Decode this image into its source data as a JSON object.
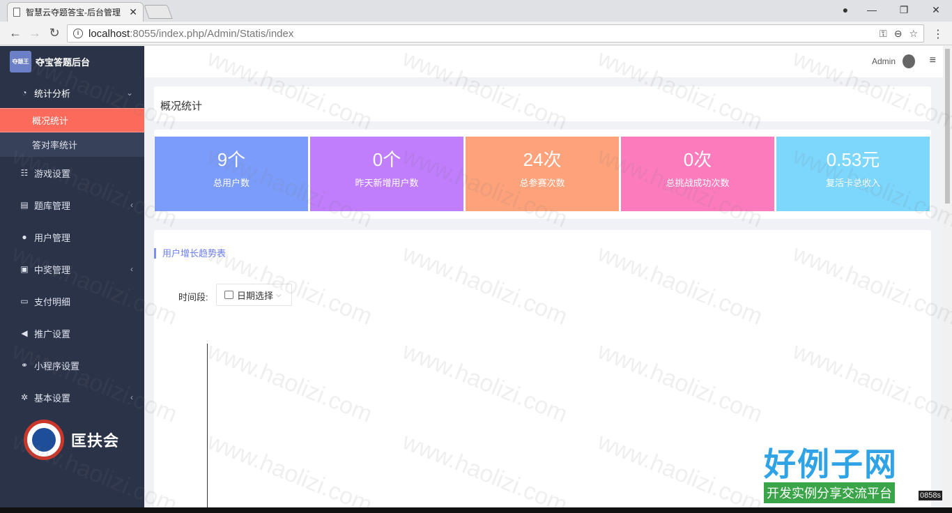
{
  "browser": {
    "tab_title": "智慧云夺题答宝-后台管理",
    "tab_close": "✕",
    "url_host": "localhost",
    "url_path": ":8055/index.php/Admin/Statis/index",
    "win_min": "—",
    "win_max": "❐",
    "win_close": "✕",
    "back": "←",
    "forward": "→",
    "reload": "↻",
    "menu": "⋮"
  },
  "sidebar": {
    "brand_logo_text": "夺题王",
    "brand_name": "夺宝答题后台",
    "group_open": {
      "label": "统计分析",
      "icon": "pie-chart-icon",
      "glyph": "◔",
      "caret": "⌄"
    },
    "sub_items": [
      {
        "label": "概况统计",
        "active": true
      },
      {
        "label": "答对率统计",
        "active": false
      }
    ],
    "items": [
      {
        "label": "游戏设置",
        "icon": "gamepad-icon",
        "glyph": "☷",
        "caret": ""
      },
      {
        "label": "题库管理",
        "icon": "list-icon",
        "glyph": "▤",
        "caret": "‹"
      },
      {
        "label": "用户管理",
        "icon": "user-icon",
        "glyph": "●",
        "caret": ""
      },
      {
        "label": "中奖管理",
        "icon": "award-icon",
        "glyph": "▣",
        "caret": "‹"
      },
      {
        "label": "支付明细",
        "icon": "card-icon",
        "glyph": "▭",
        "caret": ""
      },
      {
        "label": "推广设置",
        "icon": "bullhorn-icon",
        "glyph": "◀",
        "caret": ""
      },
      {
        "label": "小程序设置",
        "icon": "link-icon",
        "glyph": "⚭",
        "caret": ""
      },
      {
        "label": "基本设置",
        "icon": "gear-icon",
        "glyph": "✲",
        "caret": "‹"
      }
    ],
    "org_name": "匡扶会"
  },
  "topbar": {
    "user_name": "Admin",
    "menu_glyph": "≡"
  },
  "page": {
    "title": "概况统计",
    "stats": [
      {
        "value": "9个",
        "label": "总用户数",
        "color": "#7b9cfb"
      },
      {
        "value": "0个",
        "label": "昨天新增用户数",
        "color": "#c07dfc"
      },
      {
        "value": "24次",
        "label": "总参赛次数",
        "color": "#fda27a"
      },
      {
        "value": "0次",
        "label": "总挑战成功次数",
        "color": "#fc7bbd"
      },
      {
        "value": "0.53元",
        "label": "复活卡总收入",
        "color": "#7dd7fd"
      }
    ],
    "chart_section_title": "用户增长趋势表",
    "filter_label": "时间段:",
    "date_picker_text": "日期选择",
    "date_picker_chevron": "⌵"
  },
  "overlay": {
    "watermark": "www.haolizi.com",
    "badge_big": "好例子网",
    "badge_small": "开发实例分享交流平台",
    "timer": "0858s"
  }
}
